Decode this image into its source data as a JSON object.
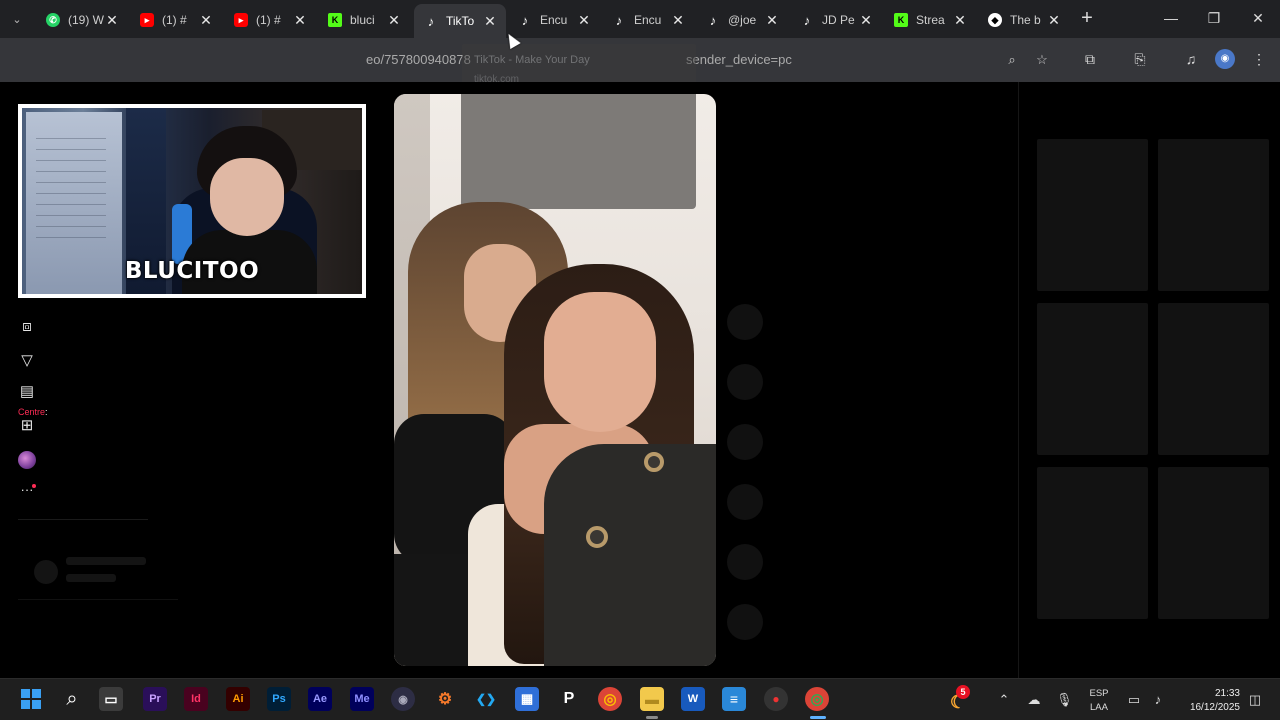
{
  "browser": {
    "tabs": [
      {
        "label": "(19) W",
        "favicon": "whatsapp-icon",
        "active": false
      },
      {
        "label": "(1) #",
        "favicon": "youtube-icon",
        "active": false
      },
      {
        "label": "(1) #",
        "favicon": "youtube-icon",
        "active": false
      },
      {
        "label": "bluci",
        "favicon": "kick-icon",
        "active": false
      },
      {
        "label": "TikTo",
        "favicon": "tiktok-icon",
        "active": true
      },
      {
        "label": "Encu",
        "favicon": "tiktok-icon",
        "active": false
      },
      {
        "label": "Encu",
        "favicon": "tiktok-icon",
        "active": false
      },
      {
        "label": "@joe",
        "favicon": "tiktok-icon",
        "active": false
      },
      {
        "label": "JD Pe",
        "favicon": "tiktok-icon",
        "active": false
      },
      {
        "label": "Strea",
        "favicon": "kick-icon",
        "active": false
      },
      {
        "label": "The b",
        "favicon": "github-icon",
        "active": false
      }
    ],
    "address": {
      "url_visible": "eo/757800940878",
      "url_tail": "sender_device=pc"
    },
    "tooltip": {
      "title": "TikTok - Make Your Day",
      "domain": "tiktok.com"
    },
    "colors": {
      "accent": "#fe2c55",
      "kick": "#53fc18",
      "youtube": "#ff0000",
      "whatsapp": "#25d366"
    }
  },
  "sidebar": {
    "items": [
      {
        "name": "explore-icon",
        "glyph": "⊘"
      },
      {
        "name": "following-icon",
        "glyph": "⚇"
      },
      {
        "name": "friends-icon",
        "glyph": "⚉"
      },
      {
        "name": "live-icon",
        "glyph": "⧈"
      },
      {
        "name": "filter-icon",
        "glyph": "▽"
      },
      {
        "name": "messages-icon",
        "glyph": "▤"
      },
      {
        "name": "upload-icon",
        "glyph": "⊞"
      }
    ],
    "label_fragment": "Centre",
    "label_colon": ":",
    "more_glyph": "···"
  },
  "webcam": {
    "streamer_name": "BLUCITOO"
  },
  "taskbar": {
    "apps": [
      {
        "name": "search-icon",
        "label": "⌕"
      },
      {
        "name": "file-explorer-icon",
        "label": "▭"
      },
      {
        "name": "premiere-icon",
        "label": "Pr"
      },
      {
        "name": "indesign-icon",
        "label": "Id"
      },
      {
        "name": "illustrator-icon",
        "label": "Ai"
      },
      {
        "name": "photoshop-icon",
        "label": "Ps"
      },
      {
        "name": "after-effects-icon",
        "label": "Ae"
      },
      {
        "name": "media-encoder-icon",
        "label": "Me"
      },
      {
        "name": "obs-icon",
        "label": "◉"
      },
      {
        "name": "blender-icon",
        "label": "⚙"
      },
      {
        "name": "vscode-icon",
        "label": "❮❯"
      },
      {
        "name": "store-icon",
        "label": "▦"
      },
      {
        "name": "search-app-icon",
        "label": "P"
      },
      {
        "name": "chrome-icon",
        "label": "◎"
      },
      {
        "name": "folder-icon",
        "label": "▬"
      },
      {
        "name": "word-icon",
        "label": "W"
      },
      {
        "name": "notepad-icon",
        "label": "≡"
      },
      {
        "name": "app-dark-icon",
        "label": "●"
      },
      {
        "name": "chrome-profile-icon",
        "label": "◎"
      }
    ],
    "weather_badge": "5",
    "language_line1": "ESP",
    "language_line2": "LAA",
    "time": "21:33",
    "date": "16/12/2025"
  }
}
